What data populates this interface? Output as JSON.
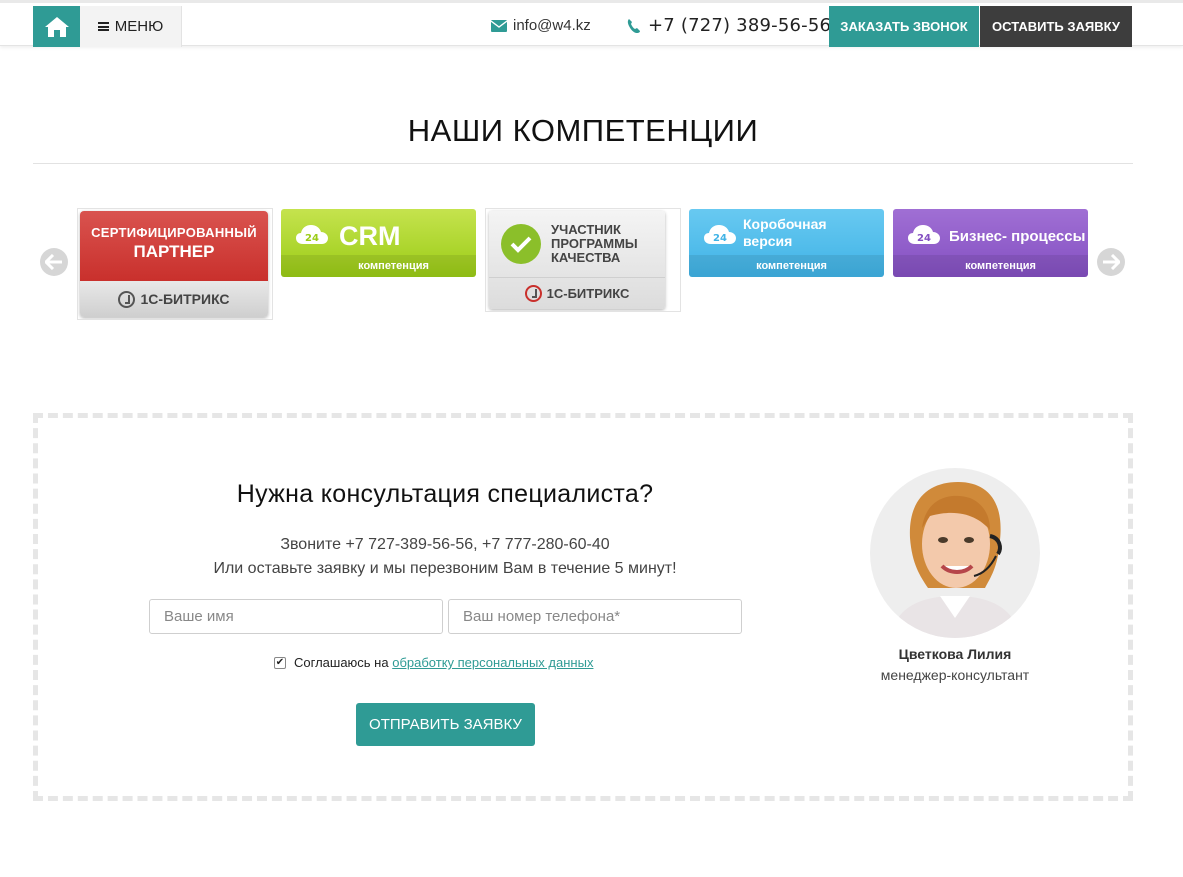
{
  "header": {
    "menu_label": "МЕНЮ",
    "email": "info@w4.kz",
    "phone": "+7 (727) 389-56-56",
    "callback_label": "ЗАКАЗАТЬ ЗВОНОК",
    "request_label": "ОСТАВИТЬ ЗАЯВКУ",
    "icons": [
      "home-icon",
      "menu-icon",
      "envelope-icon",
      "phone-icon"
    ]
  },
  "competencies": {
    "title": "НАШИ КОМПЕТЕНЦИИ",
    "badges": [
      {
        "line1": "СЕРТИФИЦИРОВАННЫЙ",
        "line2": "ПАРТНЕР",
        "brand": "1С-БИТРИКС"
      },
      {
        "cloud": "24",
        "title": "CRM",
        "sub": "компетенция"
      },
      {
        "line1": "УЧАСТНИК",
        "line2": "ПРОГРАММЫ",
        "line3": "КАЧЕСТВА",
        "brand": "1С-БИТРИКС"
      },
      {
        "cloud": "24",
        "title_line1": "Коробочная",
        "title_line2": "версия",
        "sub": "компетенция"
      },
      {
        "cloud": "24",
        "title": "Бизнес- процессы",
        "sub": "компетенция"
      }
    ]
  },
  "consultation": {
    "title": "Нужна консультация специалиста?",
    "line1": "Звоните +7 727-389-56-56, +7 777-280-60-40",
    "line2": "Или оставьте заявку и мы перезвоним Вам в течение 5 минут!",
    "name_placeholder": "Ваше имя",
    "phone_placeholder": "Ваш номер телефона*",
    "consent_text": "Соглашаюсь на",
    "consent_link": "обработку персональных данных",
    "consent_checked": true,
    "submit_label": "ОТПРАВИТЬ ЗАЯВКУ",
    "manager_name": "Цветкова Лилия",
    "manager_role": "менеджер-консультант"
  },
  "colors": {
    "accent": "#2f9b95",
    "dark": "#3d3d3d"
  }
}
